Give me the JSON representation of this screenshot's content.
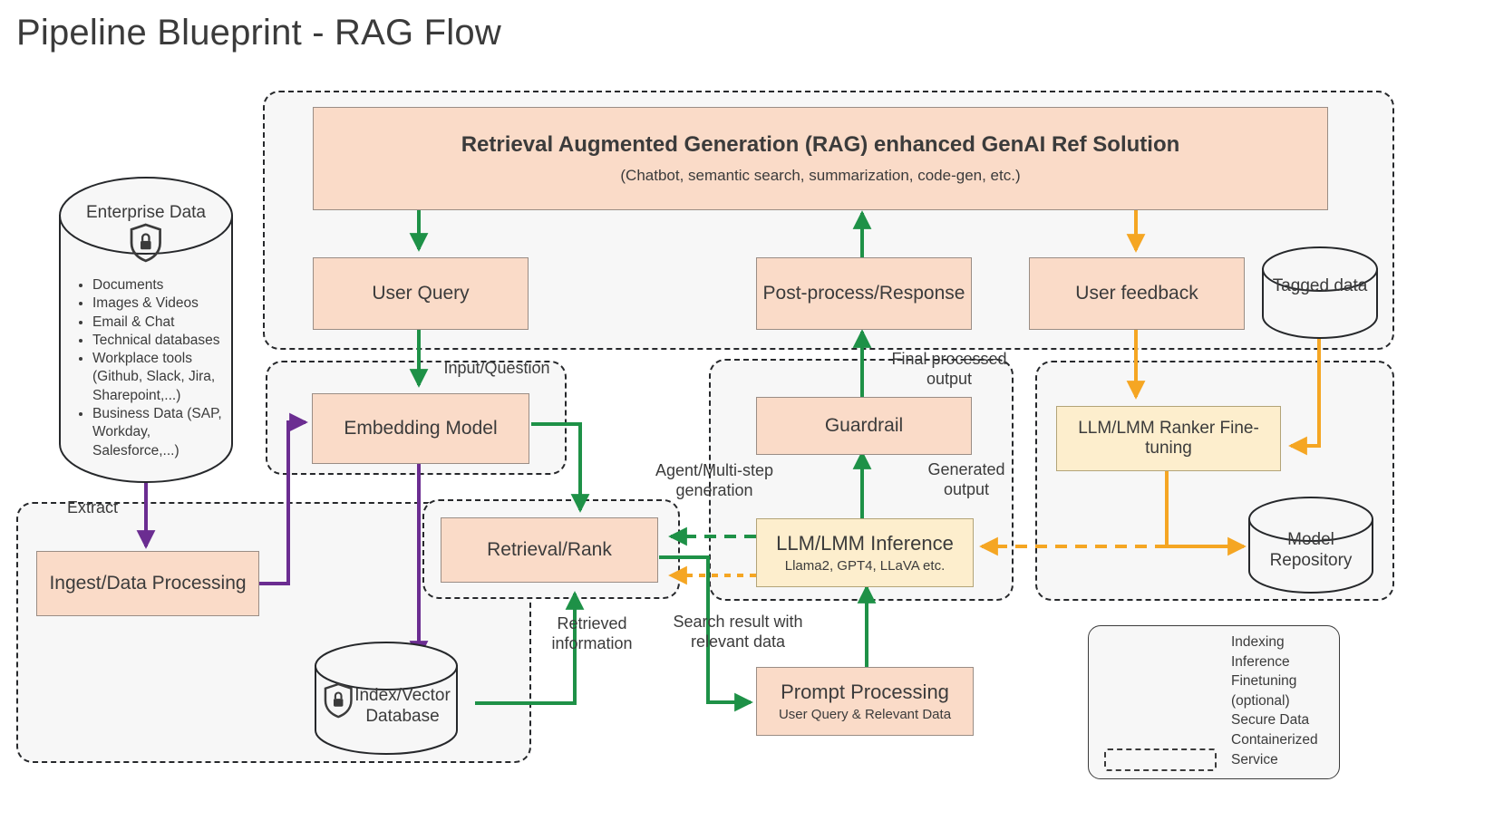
{
  "page": {
    "title": "Pipeline Blueprint - RAG Flow"
  },
  "colors": {
    "indexing": "#6b2d91",
    "inference": "#1e9147",
    "finetuning": "#f5a623",
    "box_fill": "#fadbc8",
    "box_fill_yellow": "#fdeecd",
    "group_fill": "#f7f7f7",
    "text": "#3b3b3b"
  },
  "datastores": {
    "enterprise": {
      "label": "Enterprise Data",
      "icon": "shield-lock-icon",
      "items": [
        "Documents",
        "Images & Videos",
        "Email & Chat",
        "Technical databases",
        "Workplace tools (Github, Slack, Jira, Sharepoint,...)",
        "Business Data (SAP, Workday, Salesforce,...)"
      ]
    },
    "index_vector": {
      "label": "Index/Vector Database",
      "icon": "shield-lock-icon"
    },
    "tagged": {
      "label": "Tagged data"
    },
    "model_repo": {
      "label": "Model Repository"
    }
  },
  "boxes": {
    "rag_solution": {
      "title": "Retrieval Augmented Generation (RAG) enhanced GenAI Ref Solution",
      "subtitle": "(Chatbot, semantic search, summarization, code-gen, etc.)"
    },
    "user_query": {
      "label": "User Query"
    },
    "post_process": {
      "label": "Post-process/Response"
    },
    "user_feedback": {
      "label": "User feedback"
    },
    "embedding_model": {
      "label": "Embedding Model"
    },
    "guardrail": {
      "label": "Guardrail"
    },
    "ranker_finetuning": {
      "label": "LLM/LMM Ranker Fine-tuning"
    },
    "ingest": {
      "label": "Ingest/Data Processing"
    },
    "retrieval_rank": {
      "label": "Retrieval/Rank"
    },
    "llm_inference": {
      "label": "LLM/LMM Inference",
      "sub": "Llama2, GPT4, LLaVA etc."
    },
    "prompt_processing": {
      "label": "Prompt Processing",
      "sub": "User Query & Relevant Data"
    }
  },
  "edge_labels": {
    "extract": "Extract",
    "input_question": "Input/Question",
    "final_processed_output": "Final processed\noutput",
    "generated_output": "Generated\noutput",
    "agent_multistep": "Agent/Multi-step\ngeneration",
    "retrieved_information": "Retrieved\ninformation",
    "search_result": "Search result with\nrelevant data"
  },
  "legend": {
    "entries": [
      {
        "marker": "arrow-purple-icon",
        "label": "Indexing"
      },
      {
        "marker": "arrow-green-icon",
        "label": "Inference"
      },
      {
        "marker": "arrow-yellow-icon",
        "label": "Finetuning"
      },
      {
        "marker": "none",
        "label": "(optional)"
      },
      {
        "marker": "shield-lock-icon",
        "label": "Secure Data"
      },
      {
        "marker": "none",
        "label": "Containerized"
      },
      {
        "marker": "dashed-box-icon",
        "label": "Service"
      }
    ]
  }
}
